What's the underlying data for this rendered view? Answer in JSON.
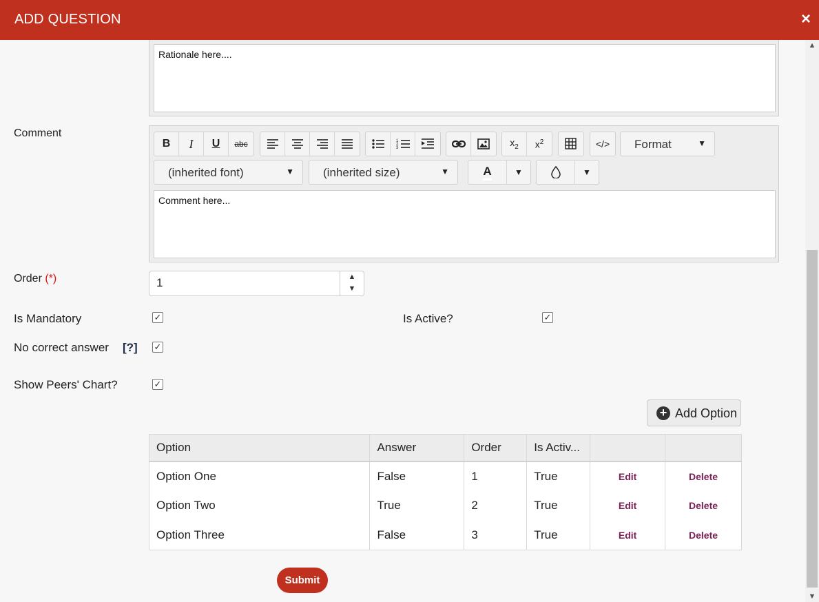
{
  "window": {
    "title": "ADD QUESTION",
    "close_glyph": "×"
  },
  "rationale": {
    "text": "Rationale here...."
  },
  "comment": {
    "label": "Comment",
    "text": "Comment here...",
    "format_label": "Format",
    "font_value": "(inherited font)",
    "size_value": "(inherited size)",
    "font_color_glyph": "A"
  },
  "order": {
    "label": "Order",
    "required_marker": "(*)",
    "value": "1"
  },
  "flags": {
    "is_mandatory": {
      "label": "Is Mandatory",
      "checked": true
    },
    "is_active": {
      "label": "Is Active?",
      "checked": true
    },
    "no_correct_answer": {
      "label": "No correct answer",
      "help": "[?]",
      "checked": true
    },
    "show_peers_chart": {
      "label": "Show Peers' Chart?",
      "checked": true
    }
  },
  "add_option_label": "Add Option",
  "options_table": {
    "columns": [
      "Option",
      "Answer",
      "Order",
      "Is Activ...",
      "",
      ""
    ],
    "rows": [
      {
        "option": "Option One",
        "answer": "False",
        "order": "1",
        "active": "True",
        "edit": "Edit",
        "delete": "Delete"
      },
      {
        "option": "Option Two",
        "answer": "True",
        "order": "2",
        "active": "True",
        "edit": "Edit",
        "delete": "Delete"
      },
      {
        "option": "Option Three",
        "answer": "False",
        "order": "3",
        "active": "True",
        "edit": "Edit",
        "delete": "Delete"
      }
    ]
  },
  "submit_label": "Submit",
  "colors": {
    "header": "#c0301e",
    "action_link": "#7b1e55",
    "required": "#dd1111"
  }
}
